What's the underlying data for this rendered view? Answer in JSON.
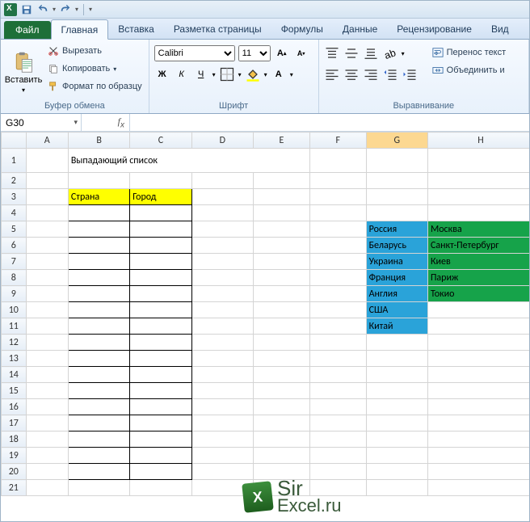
{
  "qat": {
    "save": "save",
    "undo": "undo",
    "redo": "redo"
  },
  "tabs": {
    "file": "Файл",
    "items": [
      "Главная",
      "Вставка",
      "Разметка страницы",
      "Формулы",
      "Данные",
      "Рецензирование",
      "Вид"
    ],
    "active": 0
  },
  "ribbon": {
    "clipboard": {
      "title": "Буфер обмена",
      "paste": "Вставить",
      "cut": "Вырезать",
      "copy": "Копировать",
      "format_painter": "Формат по образцу"
    },
    "font": {
      "title": "Шрифт",
      "name": "Calibri",
      "size": "11"
    },
    "alignment": {
      "title": "Выравнивание",
      "wrap": "Перенос текст",
      "merge": "Объединить и"
    }
  },
  "namebox": "G30",
  "formula": "",
  "columns": [
    "A",
    "B",
    "C",
    "D",
    "E",
    "F",
    "G",
    "H"
  ],
  "rows": [
    1,
    2,
    3,
    4,
    5,
    6,
    7,
    8,
    9,
    10,
    11,
    12,
    13,
    14,
    15,
    16,
    17,
    18,
    19,
    20,
    21
  ],
  "selected_col": "G",
  "content": {
    "title": "Выпадающий список",
    "table_headers": {
      "country": "Страна",
      "city": "Город"
    },
    "countries": [
      "Россия",
      "Беларусь",
      "Украина",
      "Франция",
      "Англия",
      "США",
      "Китай"
    ],
    "cities": [
      "Москва",
      "Санкт-Петербург",
      "Киев",
      "Париж",
      "Токио"
    ]
  },
  "watermark": {
    "line1": "Sir",
    "line2": "Excel.ru"
  }
}
